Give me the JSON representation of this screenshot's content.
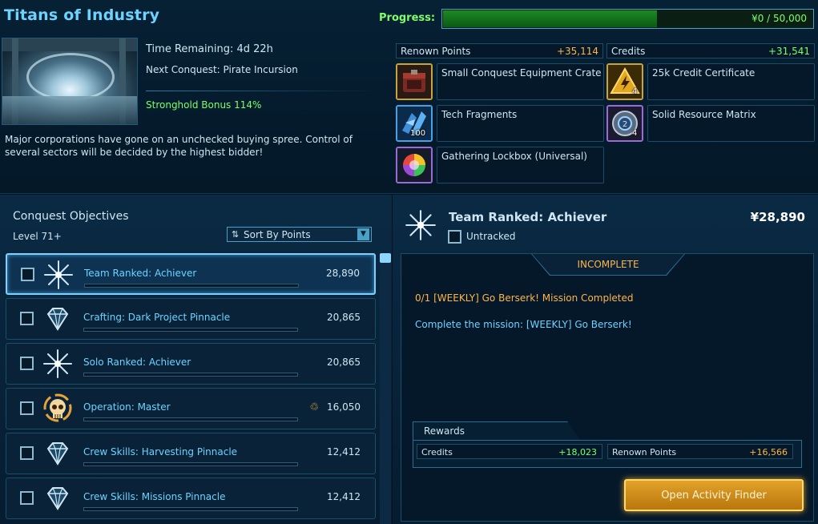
{
  "header": {
    "title": "Titans of Industry",
    "time_remaining": "Time Remaining: 4d 22h",
    "next_conquest": "Next Conquest: Pirate Incursion",
    "stronghold_bonus": "Stronghold Bonus 114%",
    "description": "Major corporations have gone on an unchecked buying spree. Control of several sectors will be decided by the highest bidder!"
  },
  "progress": {
    "label": "Progress:",
    "text": "¥0 / 50,000",
    "fill_fraction": 0.58
  },
  "summary": {
    "renown_label": "Renown Points",
    "renown_value": "+35,114",
    "credits_label": "Credits",
    "credits_value": "+31,541"
  },
  "rewards": [
    {
      "name": "Small Conquest Equipment Crate",
      "icon": "crate-icon",
      "qty": ""
    },
    {
      "name": "25k Credit Certificate",
      "icon": "credit-certificate-icon",
      "qty": "4"
    },
    {
      "name": "Tech Fragments",
      "icon": "tech-fragments-icon",
      "qty": "100"
    },
    {
      "name": "Solid Resource Matrix",
      "icon": "resource-matrix-icon",
      "qty": "4"
    },
    {
      "name": "Gathering Lockbox (Universal)",
      "icon": "lockbox-icon",
      "qty": ""
    }
  ],
  "objectives": {
    "title": "Conquest Objectives",
    "level": "Level 71+",
    "sort_label": "Sort By Points",
    "items": [
      {
        "name": "Team Ranked: Achiever",
        "points": "28,890",
        "icon": "starburst-icon"
      },
      {
        "name": "Crafting: Dark Project Pinnacle",
        "points": "20,865",
        "icon": "diamond-icon"
      },
      {
        "name": "Solo Ranked: Achiever",
        "points": "20,865",
        "icon": "starburst-icon"
      },
      {
        "name": "Operation: Master",
        "points": "16,050",
        "icon": "skull-icon"
      },
      {
        "name": "Crew Skills: Harvesting Pinnacle",
        "points": "12,412",
        "icon": "diamond-icon"
      },
      {
        "name": "Crew Skills: Missions Pinnacle",
        "points": "12,412",
        "icon": "diamond-icon"
      }
    ]
  },
  "detail": {
    "title": "Team Ranked: Achiever",
    "points": "¥28,890",
    "untracked": "Untracked",
    "status": "INCOMPLETE",
    "task": "0/1 [WEEKLY] Go Berserk! Mission Completed",
    "task_desc": "Complete the mission: [WEEKLY] Go Berserk!",
    "rewards_label": "Rewards",
    "credits_label": "Credits",
    "credits_value": "+18,023",
    "renown_label": "Renown Points",
    "renown_value": "+16,566",
    "finder_button": "Open Activity Finder"
  },
  "colors": {
    "accent": "#6cd3ff",
    "green": "#7cff6a",
    "orange": "#ffb54a",
    "button": "#e2a22a"
  }
}
